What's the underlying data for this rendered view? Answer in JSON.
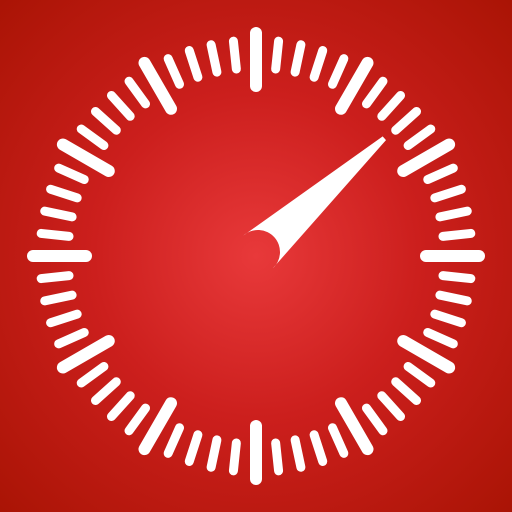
{
  "icon": {
    "name": "stopwatch-icon",
    "colors": {
      "background_center": "#e8393a",
      "background_mid": "#cc1f1d",
      "background_edge": "#aa1405",
      "marks": "#ffffff"
    },
    "dial": {
      "tick_count": 60,
      "major_every": 5
    },
    "hand": {
      "points_to_tick": 8
    }
  }
}
